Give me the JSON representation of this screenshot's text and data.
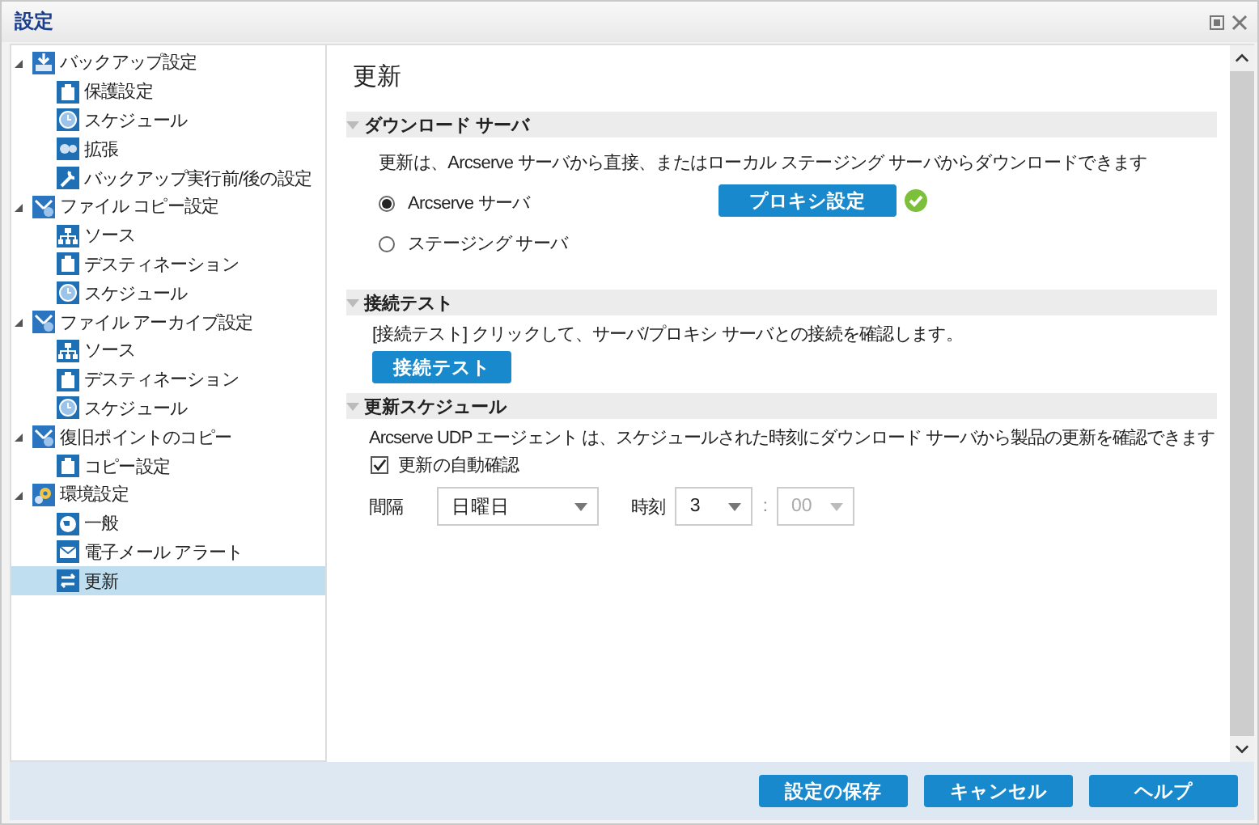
{
  "window": {
    "title": "設定"
  },
  "tree": [
    {
      "label": "バックアップ設定",
      "kind": "backup",
      "expanded": true,
      "selected": false,
      "children": [
        {
          "label": "保護設定",
          "kind": "document",
          "selected": false
        },
        {
          "label": "スケジュール",
          "kind": "clock",
          "selected": false
        },
        {
          "label": "拡張",
          "kind": "gears",
          "selected": false
        },
        {
          "label": "バックアップ実行前/後の設定",
          "kind": "wrench",
          "selected": false
        }
      ]
    },
    {
      "label": "ファイル コピー設定",
      "kind": "copy",
      "expanded": true,
      "selected": false,
      "children": [
        {
          "label": "ソース",
          "kind": "network",
          "selected": false
        },
        {
          "label": "デスティネーション",
          "kind": "document",
          "selected": false
        },
        {
          "label": "スケジュール",
          "kind": "clock",
          "selected": false
        }
      ]
    },
    {
      "label": "ファイル アーカイブ設定",
      "kind": "copy",
      "expanded": true,
      "selected": false,
      "children": [
        {
          "label": "ソース",
          "kind": "network",
          "selected": false
        },
        {
          "label": "デスティネーション",
          "kind": "document",
          "selected": false
        },
        {
          "label": "スケジュール",
          "kind": "clock",
          "selected": false
        }
      ]
    },
    {
      "label": "復旧ポイントのコピー",
      "kind": "copy",
      "expanded": true,
      "selected": false,
      "children": [
        {
          "label": "コピー設定",
          "kind": "document",
          "selected": false
        }
      ]
    },
    {
      "label": "環境設定",
      "kind": "settings",
      "expanded": true,
      "selected": false,
      "children": [
        {
          "label": "一般",
          "kind": "globe",
          "selected": false
        },
        {
          "label": "電子メール アラート",
          "kind": "mail",
          "selected": false
        },
        {
          "label": "更新",
          "kind": "update",
          "selected": true
        }
      ]
    }
  ],
  "content": {
    "title": "更新",
    "download": {
      "heading": "ダウンロード サーバ",
      "description": "更新は、Arcserve サーバから直接、またはローカル ステージング サーバからダウンロードできます",
      "options": [
        {
          "label": "Arcserve サーバ",
          "selected": true
        },
        {
          "label": "ステージング サーバ",
          "selected": false
        }
      ],
      "proxy_button": "プロキシ設定",
      "proxy_ok": true
    },
    "connection": {
      "heading": "接続テスト",
      "description": "[接続テスト] クリックして、サーバ/プロキシ サーバとの接続を確認します。",
      "button": "接続テスト"
    },
    "schedule": {
      "heading": "更新スケジュール",
      "description": "Arcserve UDP エージェント は、スケジュールされた時刻にダウンロード サーバから製品の更新を確認できます",
      "auto_check": {
        "label": "更新の自動確認",
        "checked": true
      },
      "interval_label": "間隔",
      "interval": {
        "value": "日曜日",
        "disabled": false
      },
      "time_label": "時刻",
      "hour": {
        "value": "3",
        "disabled": false
      },
      "separator": ":",
      "minute": {
        "value": "00",
        "disabled": true
      }
    }
  },
  "footer": {
    "buttons": [
      "設定の保存",
      "キャンセル",
      "ヘルプ"
    ]
  }
}
